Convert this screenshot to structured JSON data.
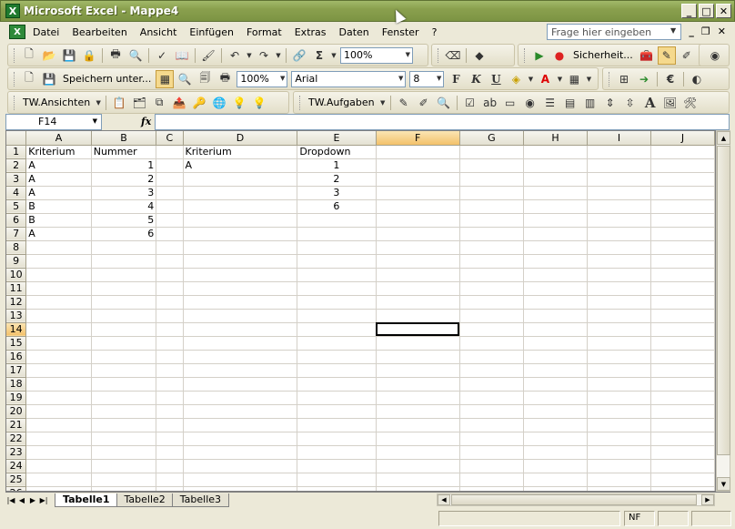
{
  "window": {
    "title": "Microsoft Excel - Mappe4",
    "app_icon": "X"
  },
  "menu": {
    "items": [
      "Datei",
      "Bearbeiten",
      "Ansicht",
      "Einfügen",
      "Format",
      "Extras",
      "Daten",
      "Fenster",
      "?"
    ],
    "help_placeholder": "Frage hier eingeben"
  },
  "toolbar1": {
    "zoom": "100%",
    "security_label": "Sicherheit..."
  },
  "toolbar2": {
    "save_as_label": "Speichern unter...",
    "zoom": "100%",
    "font": "Arial",
    "size": "8",
    "bold": "F",
    "italic": "K",
    "underline": "U",
    "euro": "€"
  },
  "toolbar3": {
    "views_label": "TW.Ansichten",
    "tasks_label": "TW.Aufgaben"
  },
  "formula": {
    "name_box": "F14",
    "fx": "fx",
    "value": ""
  },
  "columns": [
    "A",
    "B",
    "C",
    "D",
    "E",
    "F",
    "G",
    "H",
    "I",
    "J"
  ],
  "active_cell": {
    "row": 14,
    "col": "F"
  },
  "rows": [
    [
      "Kriterium",
      "Nummer",
      "",
      "Kriterium",
      "Dropdown",
      "",
      "",
      "",
      "",
      ""
    ],
    [
      "A",
      "1",
      "",
      "A",
      "1",
      "",
      "",
      "",
      "",
      ""
    ],
    [
      "A",
      "2",
      "",
      "",
      "2",
      "",
      "",
      "",
      "",
      ""
    ],
    [
      "A",
      "3",
      "",
      "",
      "3",
      "",
      "",
      "",
      "",
      ""
    ],
    [
      "B",
      "4",
      "",
      "",
      "6",
      "",
      "",
      "",
      "",
      ""
    ],
    [
      "B",
      "5",
      "",
      "",
      "",
      "",
      "",
      "",
      "",
      ""
    ],
    [
      "A",
      "6",
      "",
      "",
      "",
      "",
      "",
      "",
      "",
      ""
    ]
  ],
  "row_count": 26,
  "sheets": [
    "Tabelle1",
    "Tabelle2",
    "Tabelle3"
  ],
  "active_sheet": "Tabelle1",
  "status": {
    "nf": "NF"
  }
}
